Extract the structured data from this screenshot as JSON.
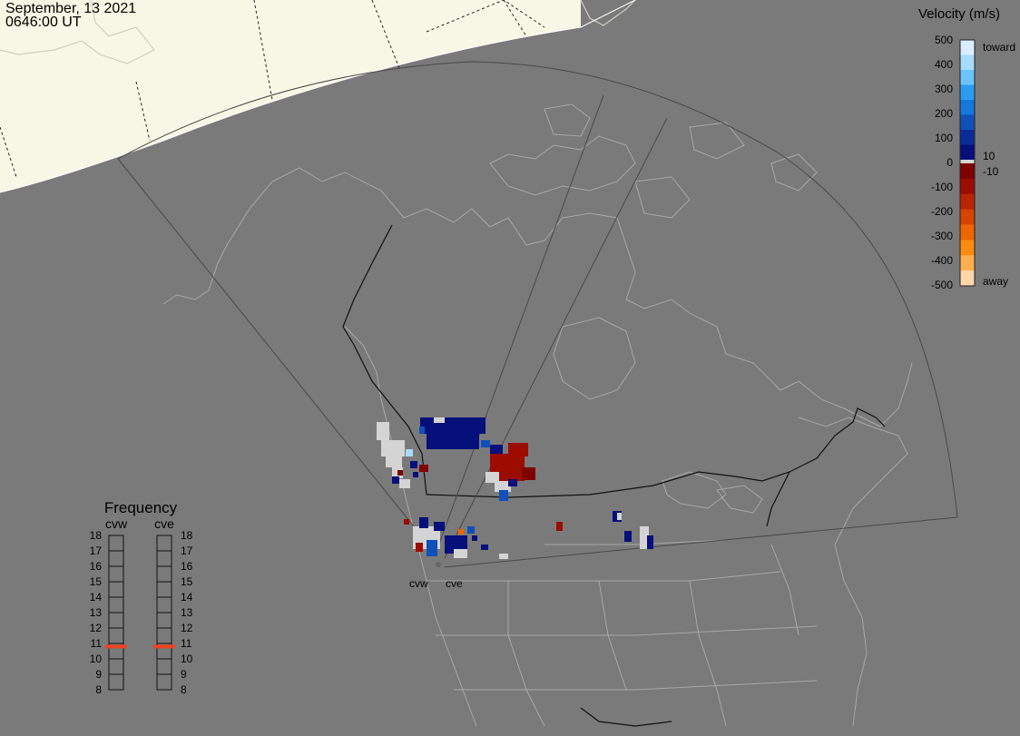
{
  "timestamp": {
    "date": "September, 13 2021",
    "time": "0646:00 UT"
  },
  "colorbar": {
    "title": "Velocity (m/s)",
    "ticks": [
      "500",
      "400",
      "300",
      "200",
      "100",
      "0",
      "-100",
      "-200",
      "-300",
      "-400",
      "-500"
    ],
    "toward_label": "toward",
    "away_label": "away",
    "threshold_pos": "10",
    "threshold_neg": "-10",
    "colors_toward": [
      "#d8eeff",
      "#a6dcff",
      "#6cc4ff",
      "#2c9cf0",
      "#1478dc",
      "#1050b8",
      "#0a2c98",
      "#06107a"
    ],
    "colors_away": [
      "#7e0000",
      "#9c0c00",
      "#ba2400",
      "#d64400",
      "#ee6600",
      "#fb8a10",
      "#ffae50",
      "#ffd6a8"
    ]
  },
  "radars": {
    "labels": [
      "cvw",
      "cve"
    ]
  },
  "frequency": {
    "title": "Frequency",
    "columns": [
      {
        "name": "cvw",
        "selected_mhz": 10.8
      },
      {
        "name": "cve",
        "selected_mhz": 10.8
      }
    ],
    "scale": [
      "18",
      "17",
      "16",
      "15",
      "14",
      "13",
      "12",
      "11",
      "10",
      "9",
      "8"
    ]
  },
  "colors": {
    "background": "#7a7a7a",
    "daylight": "#f8f6e4",
    "land_outline": "#a8a8a8",
    "border": "#111111",
    "fov": "#4a4a4a",
    "ground_scatter": "#d4d4d4",
    "freq_marker": "#ee4422"
  }
}
